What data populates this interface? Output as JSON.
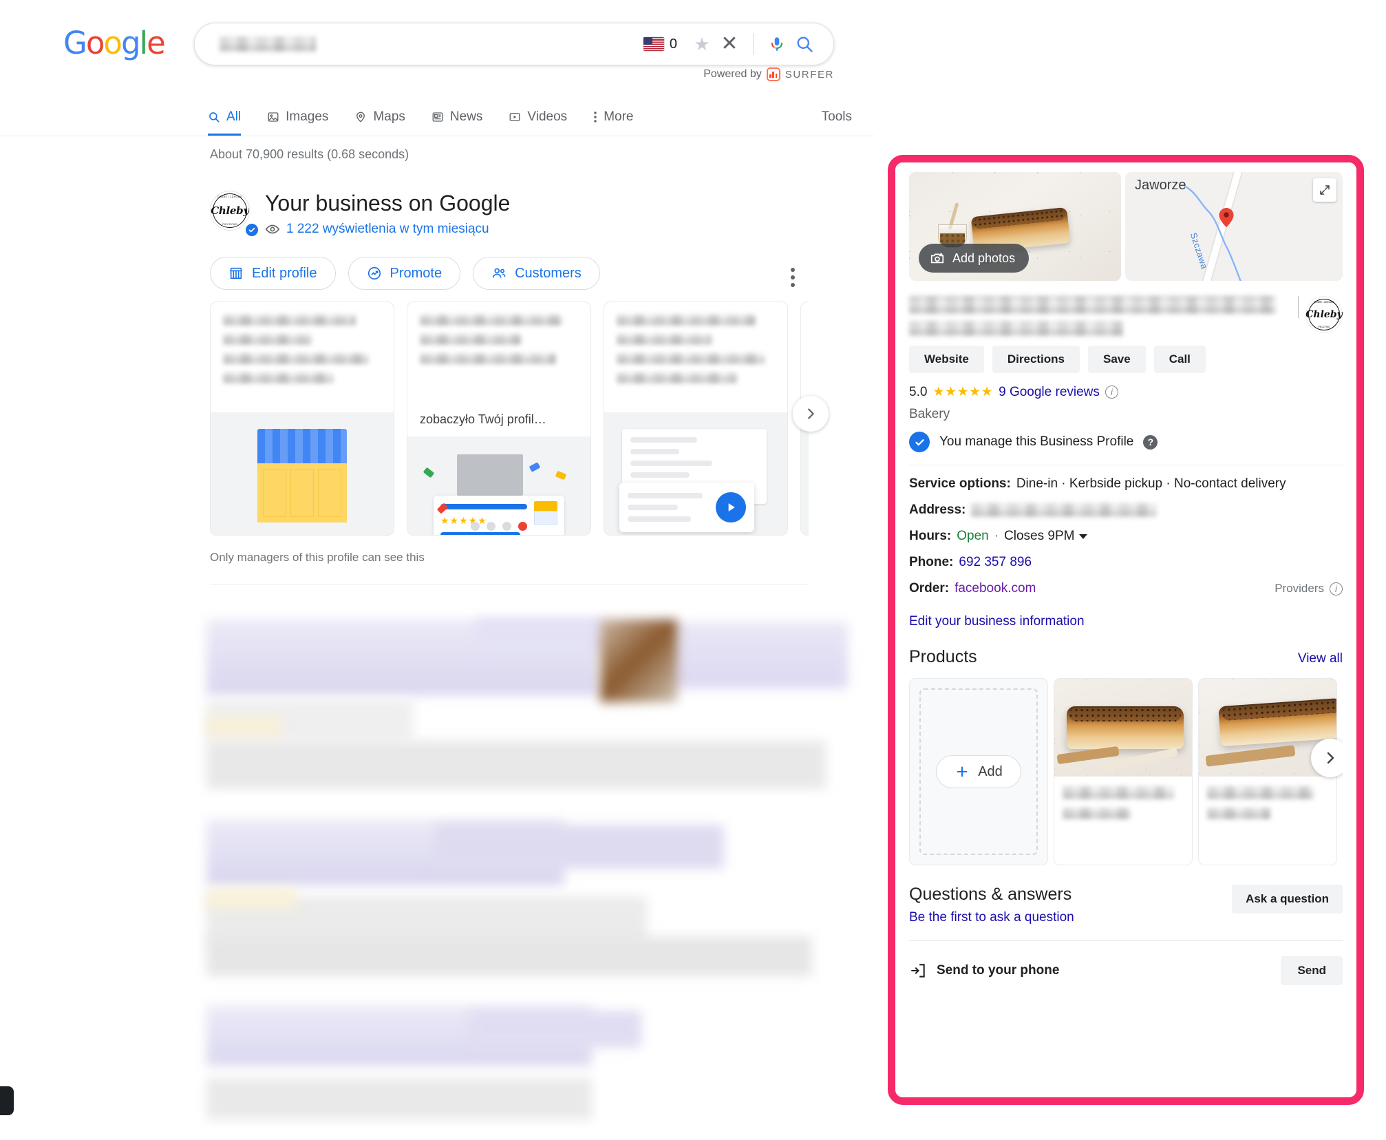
{
  "brand": {
    "logo_letters": [
      "G",
      "o",
      "o",
      "g",
      "l",
      "e"
    ]
  },
  "search": {
    "query_redacted": "",
    "flag_count": "0",
    "icons": {
      "star": "star-icon",
      "clear": "close-icon",
      "mic": "microphone-icon",
      "search": "search-icon"
    }
  },
  "powered_by": {
    "prefix": "Powered by",
    "product": "SURFER"
  },
  "nav": {
    "tabs": [
      {
        "label": "All",
        "icon": "search-icon",
        "active": true
      },
      {
        "label": "Images",
        "icon": "image-icon",
        "active": false
      },
      {
        "label": "Maps",
        "icon": "map-pin-icon",
        "active": false
      },
      {
        "label": "News",
        "icon": "newspaper-icon",
        "active": false
      },
      {
        "label": "Videos",
        "icon": "video-icon",
        "active": false
      },
      {
        "label": "More",
        "icon": "kebab-icon",
        "active": false
      }
    ],
    "tools_label": "Tools"
  },
  "results": {
    "count_text": "About 70,900 results (0.68 seconds)"
  },
  "business_panel": {
    "title": "Your business on Google",
    "views_text": "1 222 wyświetlenia w tym miesiącu",
    "logo_word": "Chleby",
    "logo_top_text": "DOBRE I ZDROWE",
    "logo_bottom_text": "PIECZYWO",
    "actions": [
      {
        "label": "Edit profile",
        "icon": "storefront-icon"
      },
      {
        "label": "Promote",
        "icon": "trending-up-icon"
      },
      {
        "label": "Customers",
        "icon": "people-icon"
      }
    ],
    "cards": [
      {
        "label": "",
        "art": "storefront-illustration"
      },
      {
        "label": "zobaczyło Twój profil…",
        "art": "review-illustration"
      },
      {
        "label": "",
        "art": "post-illustration"
      },
      {
        "label": "",
        "art": "blank-illustration"
      }
    ],
    "managers_note": "Only managers of this profile can see this"
  },
  "knowledge_panel": {
    "add_photos_label": "Add photos",
    "map": {
      "town_label": "Jaworze",
      "stream_label": "Szczawa",
      "expand_icon": "expand-icon"
    },
    "brand_word": "Chleby",
    "brand_top_text": "DOBRE I ZDROWE",
    "brand_bottom_text": "PIECZYWO",
    "actions": [
      "Website",
      "Directions",
      "Save",
      "Call"
    ],
    "rating": {
      "score": "5.0",
      "stars": "★★★★★",
      "reviews_label": "9 Google reviews"
    },
    "category": "Bakery",
    "manage_text": "You manage this Business Profile",
    "facts": {
      "service_options_label": "Service options:",
      "service_options_value": "Dine-in · Kerbside pickup · No-contact delivery",
      "address_label": "Address:",
      "address_value_redacted": "",
      "hours_label": "Hours:",
      "hours_status": "Open",
      "hours_sep": "·",
      "hours_close": "Closes 9PM",
      "phone_label": "Phone:",
      "phone_value": "692 357 896",
      "order_label": "Order:",
      "order_value": "facebook.com",
      "providers_label": "Providers"
    },
    "edit_info_link": "Edit your business information",
    "products": {
      "title": "Products",
      "view_all": "View all",
      "add_label": "Add",
      "items": [
        {
          "name_redacted": "",
          "price_redacted": ""
        },
        {
          "name_redacted": "",
          "price_redacted": ""
        }
      ]
    },
    "qa": {
      "title": "Questions & answers",
      "subtitle": "Be the first to ask a question",
      "button": "Ask a question"
    },
    "send_to_phone": {
      "label": "Send to your phone",
      "button": "Send",
      "icon": "send-to-device-icon"
    }
  },
  "colors": {
    "highlight_border": "#F62A68",
    "google_blue": "#1a73e8",
    "link_blue": "#1a0dab",
    "link_purple": "#681da8",
    "open_green": "#188038",
    "star_yellow": "#FBBC04"
  }
}
